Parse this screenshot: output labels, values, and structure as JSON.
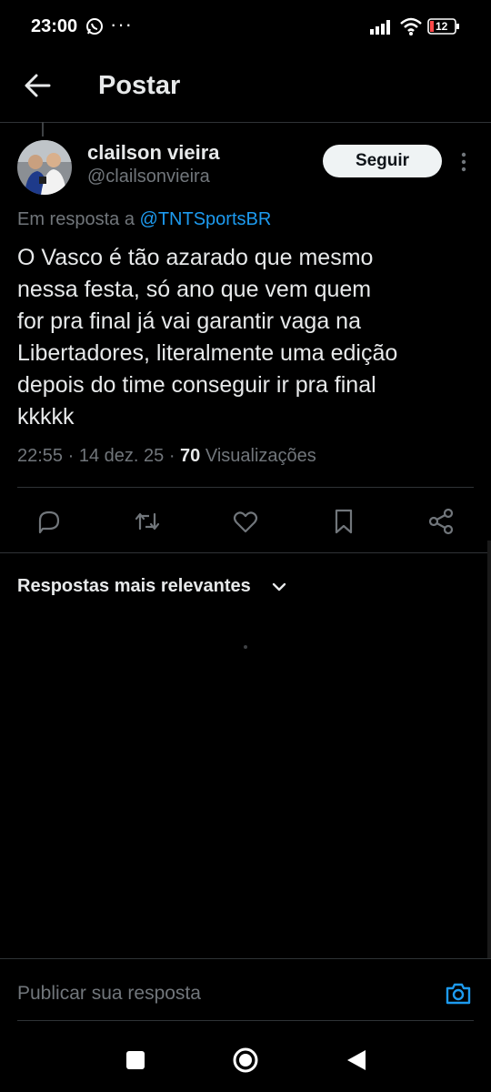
{
  "status_bar": {
    "time": "23:00",
    "overflow": "···",
    "battery": "12"
  },
  "header": {
    "title": "Postar"
  },
  "post": {
    "author_name": "clailson vieira",
    "author_handle": "@clailsonvieira",
    "follow_label": "Seguir",
    "reply_prefix": "Em resposta a",
    "reply_mention": "@TNTSportsBR",
    "text_lines": [
      "O Vasco é tão azarado que mesmo",
      "nessa festa, só ano que vem quem",
      "for pra final já vai garantir vaga na",
      "Libertadores, literalmente uma edição",
      "depois do time conseguir ir pra final",
      "kkkkk"
    ],
    "time": "22:55",
    "date": "14 dez. 25",
    "views_count": "70",
    "views_label": "Visualizações"
  },
  "replies": {
    "sort_label": "Respostas mais relevantes"
  },
  "composer": {
    "placeholder": "Publicar sua resposta"
  },
  "icons": {
    "back": "arrow-left-icon",
    "more": "more-vertical-icon",
    "reply": "reply-icon",
    "repost": "repost-icon",
    "like": "heart-icon",
    "bookmark": "bookmark-icon",
    "share": "share-icon",
    "camera": "camera-icon"
  },
  "colors": {
    "accent": "#1d9bf0",
    "background": "#000000",
    "text": "#e7e9ea",
    "muted": "#71767b"
  }
}
